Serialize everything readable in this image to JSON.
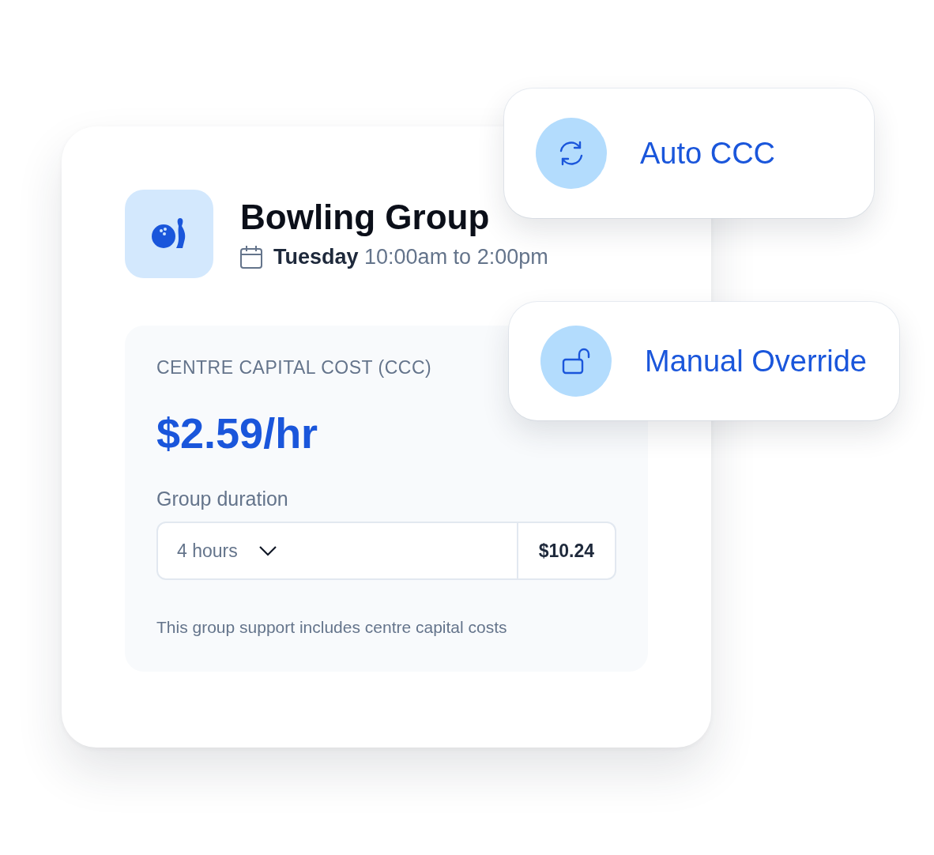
{
  "group": {
    "title": "Bowling Group",
    "schedule": "**Tuesday** 10:00am to 2:00pm"
  },
  "cost": {
    "label": "CENTRE CAPITAL COST (CCC)",
    "rate": "$2.59/hr",
    "duration_label": "Group duration",
    "duration": "4 hours",
    "amount": "$10.24",
    "note": "This group support includes centre capital costs"
  },
  "modes": [
    {
      "kind": "auto",
      "label": "Auto CCC"
    },
    {
      "kind": "manual",
      "label": "Manual Override"
    }
  ]
}
